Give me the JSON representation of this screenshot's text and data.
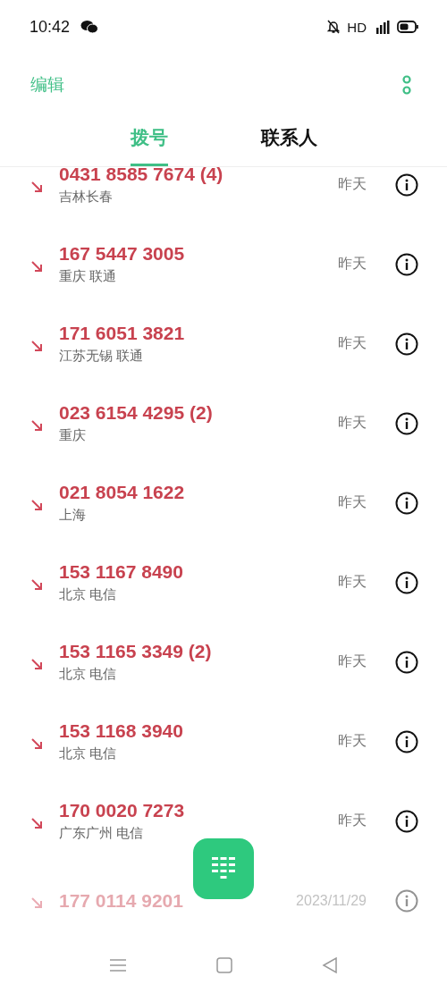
{
  "status_bar": {
    "time": "10:42",
    "network": "HD"
  },
  "header": {
    "edit": "编辑"
  },
  "tabs": [
    {
      "label": "拨号",
      "selected": true
    },
    {
      "label": "联系人",
      "selected": false
    }
  ],
  "calls": [
    {
      "number": "0431 8585 7674 (4)",
      "location": "吉林长春",
      "date": "昨天",
      "faded": false
    },
    {
      "number": "167 5447 3005",
      "location": "重庆 联通",
      "date": "昨天",
      "faded": false
    },
    {
      "number": "171 6051 3821",
      "location": "江苏无锡 联通",
      "date": "昨天",
      "faded": false
    },
    {
      "number": "023 6154 4295 (2)",
      "location": "重庆",
      "date": "昨天",
      "faded": false
    },
    {
      "number": "021 8054 1622",
      "location": "上海",
      "date": "昨天",
      "faded": false
    },
    {
      "number": "153 1167 8490",
      "location": "北京 电信",
      "date": "昨天",
      "faded": false
    },
    {
      "number": "153 1165 3349 (2)",
      "location": "北京 电信",
      "date": "昨天",
      "faded": false
    },
    {
      "number": "153 1168 3940",
      "location": "北京 电信",
      "date": "昨天",
      "faded": false
    },
    {
      "number": "170 0020 7273",
      "location": "广东广州 电信",
      "date": "昨天",
      "faded": false
    },
    {
      "number": "177 0114 9201",
      "date": "2023/11/29",
      "faded": true
    }
  ]
}
